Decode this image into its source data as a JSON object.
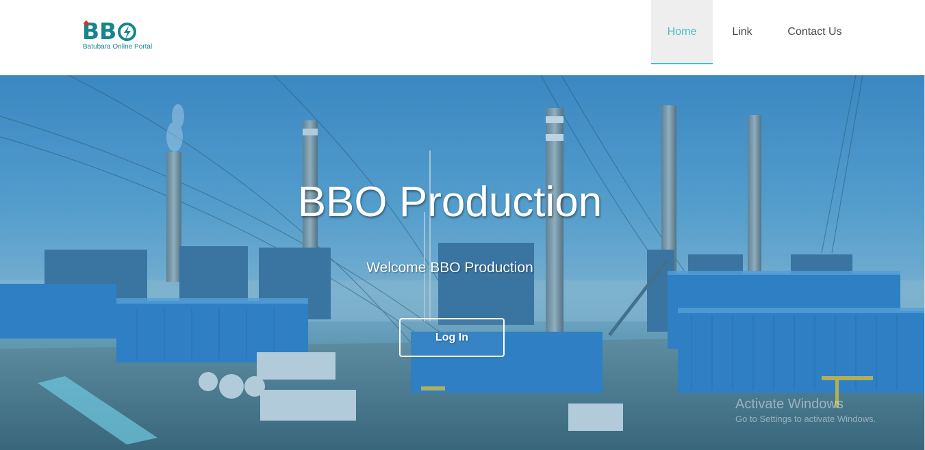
{
  "navbar": {
    "brand": {
      "logo_text": "BB",
      "tagline": "Batubara Online Portal"
    },
    "links": [
      {
        "label": "Home",
        "active": true
      },
      {
        "label": "Link",
        "active": false
      },
      {
        "label": "Contact Us",
        "active": false
      }
    ]
  },
  "hero": {
    "title": "BBO Production",
    "subtitle": "Welcome BBO Production",
    "button_label": "Log In"
  },
  "watermark": {
    "title": "Activate Windows",
    "subtitle": "Go to Settings to activate Windows."
  },
  "colors": {
    "accent": "#44bfc6",
    "brand": "#16858d",
    "brand_red": "#d9312b",
    "active_tab_bg": "#eeeeee"
  }
}
